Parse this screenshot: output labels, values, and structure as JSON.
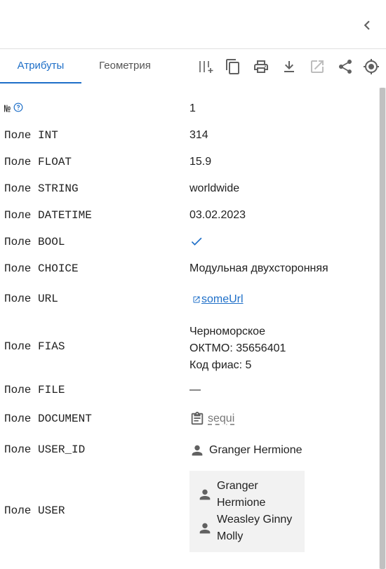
{
  "tabs": [
    {
      "label": "Атрибуты",
      "active": true
    },
    {
      "label": "Геометрия",
      "active": false
    }
  ],
  "toolbar": [
    "columns-plus-icon",
    "copy-icon",
    "print-icon",
    "download-icon",
    "open-external-icon",
    "share-icon",
    "locate-icon"
  ],
  "colors": {
    "accent": "#1e6fc8",
    "text": "#212121",
    "muted": "#777777"
  },
  "fields": {
    "num": {
      "label": "№",
      "value": "1"
    },
    "int": {
      "label": "Поле INT",
      "value": "314"
    },
    "float": {
      "label": "Поле FLOAT",
      "value": "15.9"
    },
    "string": {
      "label": "Поле STRING",
      "value": "worldwide"
    },
    "datetime": {
      "label": "Поле DATETIME",
      "value": "03.02.2023"
    },
    "bool": {
      "label": "Поле BOOL",
      "value": true
    },
    "choice": {
      "label": "Поле CHOICE",
      "value": "Модульная двухсторонняя"
    },
    "url": {
      "label": "Поле URL",
      "value": "someUrl"
    },
    "fias": {
      "label": "Поле FIAS",
      "lines": [
        "Черноморское",
        "ОКТМО: 35656401",
        "Код фиас: 5"
      ]
    },
    "file": {
      "label": "Поле FILE",
      "value": "—"
    },
    "document": {
      "label": "Поле DOCUMENT",
      "value": "sequi"
    },
    "user_id": {
      "label": "Поле USER_ID",
      "value": "Granger Hermione"
    },
    "user": {
      "label": "Поле USER",
      "users": [
        "Granger Hermione",
        "Weasley Ginny Molly"
      ]
    }
  }
}
